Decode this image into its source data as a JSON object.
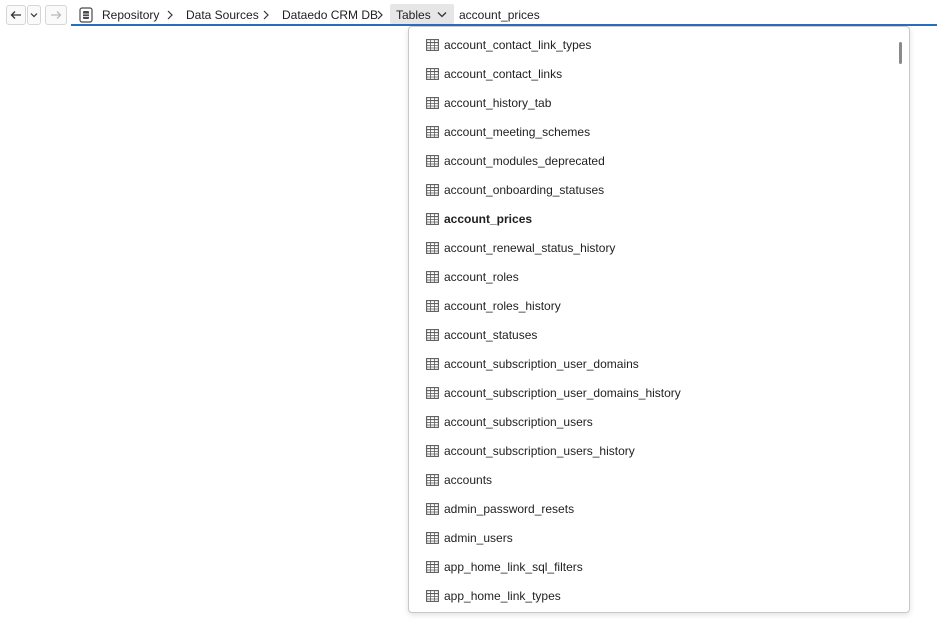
{
  "breadcrumb": {
    "items": [
      "Repository",
      "Data Sources",
      "Dataedo CRM DB",
      "Tables",
      "account_prices"
    ]
  },
  "dropdown": {
    "selected": "account_prices",
    "items": [
      "account_contact_link_types",
      "account_contact_links",
      "account_history_tab",
      "account_meeting_schemes",
      "account_modules_deprecated",
      "account_onboarding_statuses",
      "account_prices",
      "account_renewal_status_history",
      "account_roles",
      "account_roles_history",
      "account_statuses",
      "account_subscription_user_domains",
      "account_subscription_user_domains_history",
      "account_subscription_users",
      "account_subscription_users_history",
      "accounts",
      "admin_password_resets",
      "admin_users",
      "app_home_link_sql_filters",
      "app_home_link_types"
    ]
  },
  "colors": {
    "accent": "#2a6ebb",
    "icon": "#5a5a5a"
  },
  "icons": {
    "back": "arrow-left-icon",
    "history": "chevron-down-icon",
    "forward": "arrow-right-icon",
    "database": "database-icon",
    "separator": "chevron-right-icon",
    "table": "table-icon"
  }
}
